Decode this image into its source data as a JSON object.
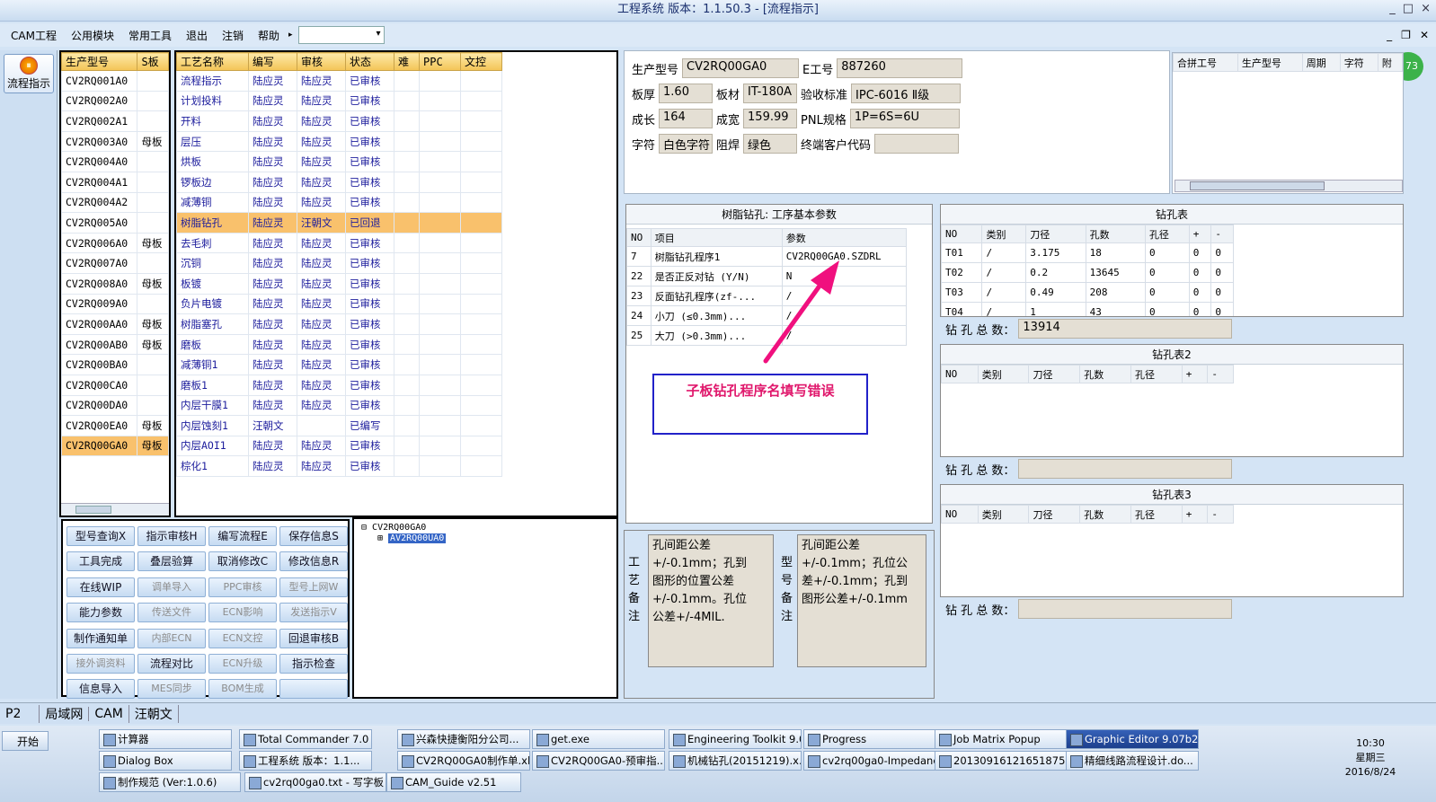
{
  "app": {
    "title": "工程系统 版本：1.1.50.3 - [流程指示]",
    "win_min": "_",
    "win_max": "□",
    "win_close": "×",
    "mdi_min": "_",
    "mdi_max": "❐",
    "mdi_close": "✕"
  },
  "menu": [
    "CAM工程",
    "公用模块",
    "常用工具",
    "退出",
    "注销",
    "帮助"
  ],
  "menu_extra": "▸",
  "flow_button": "流程指示",
  "models": {
    "headers": [
      "生产型号",
      "S板"
    ],
    "rows": [
      [
        "CV2RQ001A0",
        ""
      ],
      [
        "CV2RQ002A0",
        ""
      ],
      [
        "CV2RQ002A1",
        ""
      ],
      [
        "CV2RQ003A0",
        "母板"
      ],
      [
        "CV2RQ004A0",
        ""
      ],
      [
        "CV2RQ004A1",
        ""
      ],
      [
        "CV2RQ004A2",
        ""
      ],
      [
        "CV2RQ005A0",
        ""
      ],
      [
        "CV2RQ006A0",
        "母板"
      ],
      [
        "CV2RQ007A0",
        ""
      ],
      [
        "CV2RQ008A0",
        "母板"
      ],
      [
        "CV2RQ009A0",
        ""
      ],
      [
        "CV2RQ00AA0",
        "母板"
      ],
      [
        "CV2RQ00AB0",
        "母板"
      ],
      [
        "CV2RQ00BA0",
        ""
      ],
      [
        "CV2RQ00CA0",
        ""
      ],
      [
        "CV2RQ00DA0",
        ""
      ],
      [
        "CV2RQ00EA0",
        "母板"
      ],
      [
        "CV2RQ00GA0",
        "母板"
      ]
    ]
  },
  "process": {
    "headers": [
      "工艺名称",
      "编写",
      "审核",
      "状态",
      "难",
      "PPC",
      "文控"
    ],
    "rows": [
      [
        "流程指示",
        "陆应灵",
        "陆应灵",
        "已审核"
      ],
      [
        "计划投料",
        "陆应灵",
        "陆应灵",
        "已审核"
      ],
      [
        "开料",
        "陆应灵",
        "陆应灵",
        "已审核"
      ],
      [
        "层压",
        "陆应灵",
        "陆应灵",
        "已审核"
      ],
      [
        "烘板",
        "陆应灵",
        "陆应灵",
        "已审核"
      ],
      [
        "锣板边",
        "陆应灵",
        "陆应灵",
        "已审核"
      ],
      [
        "减薄铜",
        "陆应灵",
        "陆应灵",
        "已审核"
      ],
      [
        "树脂钻孔",
        "陆应灵",
        "汪朝文",
        "已回退"
      ],
      [
        "去毛刺",
        "陆应灵",
        "陆应灵",
        "已审核"
      ],
      [
        "沉铜",
        "陆应灵",
        "陆应灵",
        "已审核"
      ],
      [
        "板镀",
        "陆应灵",
        "陆应灵",
        "已审核"
      ],
      [
        "负片电镀",
        "陆应灵",
        "陆应灵",
        "已审核"
      ],
      [
        "树脂塞孔",
        "陆应灵",
        "陆应灵",
        "已审核"
      ],
      [
        "磨板",
        "陆应灵",
        "陆应灵",
        "已审核"
      ],
      [
        "减薄铜1",
        "陆应灵",
        "陆应灵",
        "已审核"
      ],
      [
        "磨板1",
        "陆应灵",
        "陆应灵",
        "已审核"
      ],
      [
        "内层干膜1",
        "陆应灵",
        "陆应灵",
        "已审核"
      ],
      [
        "内层蚀刻1",
        "汪朝文",
        "",
        "已编写"
      ],
      [
        "内层AOI1",
        "陆应灵",
        "陆应灵",
        "已审核"
      ],
      [
        "棕化1",
        "陆应灵",
        "陆应灵",
        "已审核"
      ]
    ]
  },
  "buttons": [
    [
      "型号查询X",
      false
    ],
    [
      "指示审核H",
      false
    ],
    [
      "编写流程E",
      false
    ],
    [
      "保存信息S",
      false
    ],
    [
      "工具完成",
      false
    ],
    [
      "叠层验算",
      false
    ],
    [
      "取消修改C",
      false
    ],
    [
      "修改信息R",
      false
    ],
    [
      "在线WIP",
      false
    ],
    [
      "调单导入",
      true
    ],
    [
      "PPC审核",
      true
    ],
    [
      "型号上网W",
      true
    ],
    [
      "能力参数",
      false
    ],
    [
      "传送文件",
      true
    ],
    [
      "ECN影响",
      true
    ],
    [
      "发送指示V",
      true
    ],
    [
      "制作通知单",
      false
    ],
    [
      "内部ECN",
      true
    ],
    [
      "ECN文控",
      true
    ],
    [
      "回退审核B",
      false
    ],
    [
      "接外调资料",
      true
    ],
    [
      "流程对比",
      false
    ],
    [
      "ECN升级",
      true
    ],
    [
      "指示检查",
      false
    ],
    [
      "信息导入",
      false
    ],
    [
      "MES同步",
      true
    ],
    [
      "BOM生成",
      true
    ],
    [
      "",
      false
    ]
  ],
  "tree": {
    "root": "CV2RQ00GA0",
    "child": "AV2RQ00UA0"
  },
  "info": {
    "label_model": "生产型号",
    "model": "CV2RQ00GA0",
    "label_eid": "E工号",
    "eid": "887260",
    "label_thick": "板厚",
    "thick": "1.60",
    "label_mat": "板材",
    "mat": "IT-180A",
    "label_std": "验收标准",
    "std": "IPC-6016 Ⅱ级",
    "label_len": "成长",
    "len": "164",
    "label_wid": "成宽",
    "wid": "159.99",
    "label_pnl": "PNL规格",
    "pnl": "1P=6S=6U",
    "label_char": "字符",
    "char": "白色字符",
    "label_mask": "阻焊",
    "mask": "绿色",
    "label_cust": "终端客户代码",
    "cust": ""
  },
  "merge": {
    "headers": [
      "合拼工号",
      "生产型号",
      "周期",
      "字符",
      "附"
    ]
  },
  "params": {
    "title": "树脂钻孔: 工序基本参数",
    "headers": [
      "NO",
      "项目",
      "参数"
    ],
    "rows": [
      [
        "7",
        "树脂钻孔程序1",
        "CV2RQ00GA0.SZDRL"
      ],
      [
        "22",
        "是否正反对钻 (Y/N)",
        "N"
      ],
      [
        "23",
        "反面钻孔程序(zf-...",
        "/"
      ],
      [
        "24",
        "小刀 (≤0.3mm)...",
        "/"
      ],
      [
        "25",
        "大刀 (>0.3mm)...",
        "/"
      ]
    ]
  },
  "annotation": "子板钻孔程序名填写错误",
  "drill1": {
    "title": "钻孔表",
    "headers": [
      "NO",
      "类别",
      "刀径",
      "孔数",
      "孔径",
      "+",
      "-"
    ],
    "rows": [
      [
        "T01",
        "/",
        "3.175",
        "18",
        "0",
        "0",
        "0"
      ],
      [
        "T02",
        "/",
        "0.2",
        "13645",
        "0",
        "0",
        "0"
      ],
      [
        "T03",
        "/",
        "0.49",
        "208",
        "0",
        "0",
        "0"
      ],
      [
        "T04",
        "/",
        "1",
        "43",
        "0",
        "0",
        "0"
      ]
    ],
    "sum_label": "钻 孔 总 数：",
    "sum": "13914"
  },
  "drill2": {
    "title": "钻孔表2",
    "headers": [
      "NO",
      "类别",
      "刀径",
      "孔数",
      "孔径",
      "+",
      "-"
    ],
    "sum_label": "钻 孔 总 数：",
    "sum": ""
  },
  "drill3": {
    "title": "钻孔表3",
    "headers": [
      "NO",
      "类别",
      "刀径",
      "孔数",
      "孔径",
      "+",
      "-"
    ],
    "sum_label": "钻 孔 总 数：",
    "sum": ""
  },
  "remarks": {
    "proc_label": "工艺备注",
    "proc_text": "孔间距公差+/-0.1mm；孔到图形的位置公差+/-0.1mm。孔位公差+/-4MIL.",
    "model_label": "型号备注",
    "model_text": "孔间距公差+/-0.1mm；孔位公差+/-0.1mm；孔到图形公差+/-0.1mm"
  },
  "status": {
    "combo": "P2",
    "tabs": [
      "局域网",
      "CAM",
      "汪朝文"
    ]
  },
  "taskbar": {
    "start": "开始",
    "row1": [
      "计算器",
      "Total Commander 7.0 ...",
      "兴森快捷衡阳分公司...",
      "get.exe",
      "Engineering Toolkit 9.0...",
      "Progress",
      "Job Matrix Popup",
      "Graphic Editor 9.07b2 ..."
    ],
    "row2": [
      "Dialog Box",
      "工程系统 版本：1.1...",
      "CV2RQ00GA0制作单.xl...",
      "CV2RQ00GA0-预审指...",
      "机械钻孔(20151219).x...",
      "cv2rq00ga0-Impedance...",
      "20130916121651875.rt...",
      "精细线路流程设计.do..."
    ],
    "row3": [
      "制作规范 (Ver:1.0.6)",
      "cv2rq00ga0.txt - 写字板",
      "CAM_Guide v2.51"
    ],
    "time": "10:30",
    "weekday": "星期三",
    "date": "2016/8/24"
  },
  "badge": "73"
}
